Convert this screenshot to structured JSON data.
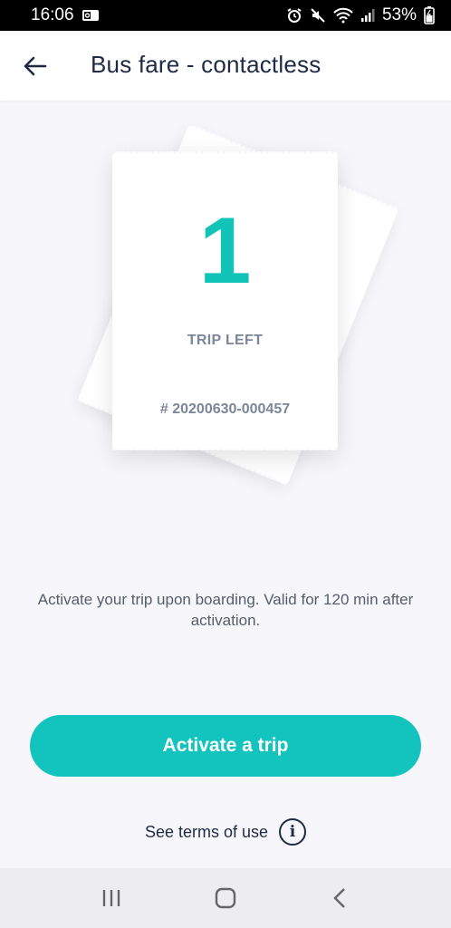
{
  "status_bar": {
    "time": "16:06",
    "battery": "53%"
  },
  "header": {
    "title": "Bus fare - contactless"
  },
  "ticket": {
    "count": "1",
    "label": "TRIP LEFT",
    "number": "# 20200630-000457"
  },
  "info": {
    "text": "Activate your trip upon boarding. Valid for 120 min after activation."
  },
  "activate": {
    "label": "Activate a trip"
  },
  "terms": {
    "label": "See terms of use"
  },
  "icons": {
    "back": "arrow-left",
    "info": "info-circle",
    "nav_recents": "three-bars",
    "nav_home": "rounded-square",
    "nav_back": "chevron-left"
  },
  "colors": {
    "accent": "#12c4bd",
    "title": "#1f2a44",
    "muted": "#7a869a",
    "background": "#f7f7fb"
  }
}
